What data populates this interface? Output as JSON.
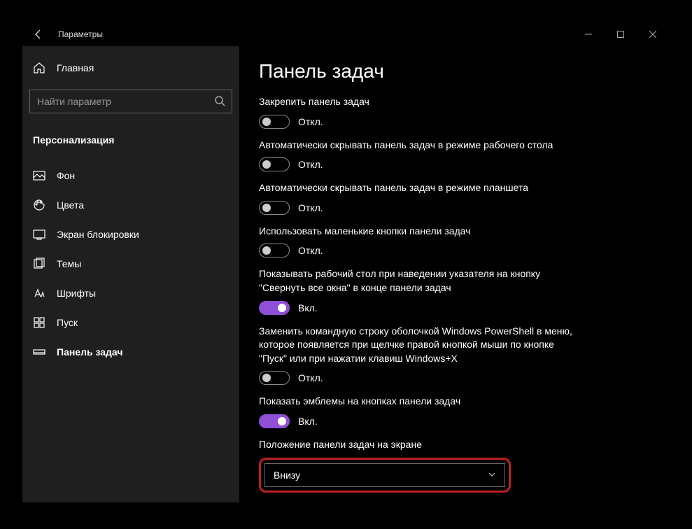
{
  "header": {
    "app_title": "Параметры"
  },
  "sidebar": {
    "home": "Главная",
    "search_placeholder": "Найти параметр",
    "category": "Персонализация",
    "items": [
      {
        "label": "Фон"
      },
      {
        "label": "Цвета"
      },
      {
        "label": "Экран блокировки"
      },
      {
        "label": "Темы"
      },
      {
        "label": "Шрифты"
      },
      {
        "label": "Пуск"
      },
      {
        "label": "Панель задач"
      }
    ]
  },
  "page": {
    "title": "Панель задач",
    "settings": [
      {
        "label": "Закрепить панель задач",
        "state": false,
        "state_text": "Откл."
      },
      {
        "label": "Автоматически скрывать панель задач в режиме рабочего стола",
        "state": false,
        "state_text": "Откл."
      },
      {
        "label": "Автоматически скрывать панель задач в режиме планшета",
        "state": false,
        "state_text": "Откл."
      },
      {
        "label": "Использовать маленькие кнопки панели задач",
        "state": false,
        "state_text": "Откл."
      },
      {
        "label": "Показывать рабочий стол при наведении указателя на кнопку \"Свернуть все окна\" в конце панели задач",
        "state": true,
        "state_text": "Вкл."
      },
      {
        "label": "Заменить командную строку оболочкой Windows PowerShell в меню, которое появляется при щелчке правой кнопкой мыши по кнопке \"Пуск\" или при нажатии клавиш Windows+X",
        "state": false,
        "state_text": "Откл."
      },
      {
        "label": "Показать эмблемы на кнопках панели задач",
        "state": true,
        "state_text": "Вкл."
      }
    ],
    "dropdown": {
      "label": "Положение панели задач на экране",
      "value": "Внизу"
    }
  }
}
